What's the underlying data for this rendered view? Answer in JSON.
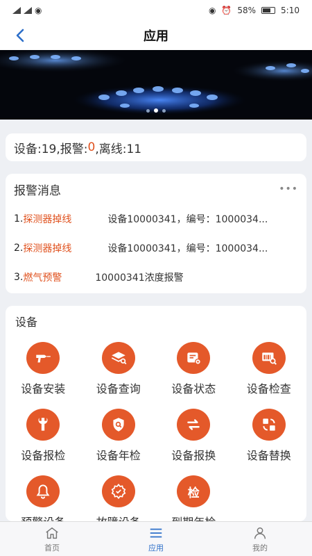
{
  "status_bar": {
    "left_text": "4G 46 HD",
    "battery": "58%",
    "time": "5:10"
  },
  "header": {
    "title": "应用"
  },
  "banner": {
    "slide_count": 3,
    "active_slide": 2
  },
  "stats": {
    "devices_label": "设备:19,报警:",
    "alarm_count": "0",
    "offline_label": ",离线:11"
  },
  "alarms": {
    "title": "报警消息",
    "more_label": "•••",
    "items": [
      {
        "index": "1.",
        "type": "探测器掉线",
        "detail": "设备10000341，编号：1000034..."
      },
      {
        "index": "2.",
        "type": "探测器掉线",
        "detail": "设备10000341，编号：1000034..."
      },
      {
        "index": "3.",
        "type": "燃气预警",
        "detail": "10000341浓度报警"
      }
    ]
  },
  "devices": {
    "title": "设备",
    "items": [
      {
        "label": "设备安装",
        "icon": "drill-icon"
      },
      {
        "label": "设备查询",
        "icon": "layers-search-icon"
      },
      {
        "label": "设备状态",
        "icon": "device-status-icon"
      },
      {
        "label": "设备检查",
        "icon": "inspect-icon"
      },
      {
        "label": "设备报检",
        "icon": "wrench-icon"
      },
      {
        "label": "设备年检",
        "icon": "shield-search-icon"
      },
      {
        "label": "设备报换",
        "icon": "swap-arrows-icon"
      },
      {
        "label": "设备替换",
        "icon": "replace-icon"
      },
      {
        "label": "预警设备",
        "icon": "bell-icon"
      },
      {
        "label": "故障设备",
        "icon": "fault-gear-icon"
      },
      {
        "label": "到期年检",
        "icon": "check-char-icon",
        "glyph": "检"
      }
    ]
  },
  "tabbar": {
    "items": [
      {
        "label": "首页",
        "icon": "home-icon",
        "active": false
      },
      {
        "label": "应用",
        "icon": "menu-icon",
        "active": true
      },
      {
        "label": "我的",
        "icon": "user-icon",
        "active": false
      }
    ]
  },
  "colors": {
    "accent": "#e4592a",
    "alarm_text": "#e0521f",
    "tab_active": "#2d6fc9"
  }
}
